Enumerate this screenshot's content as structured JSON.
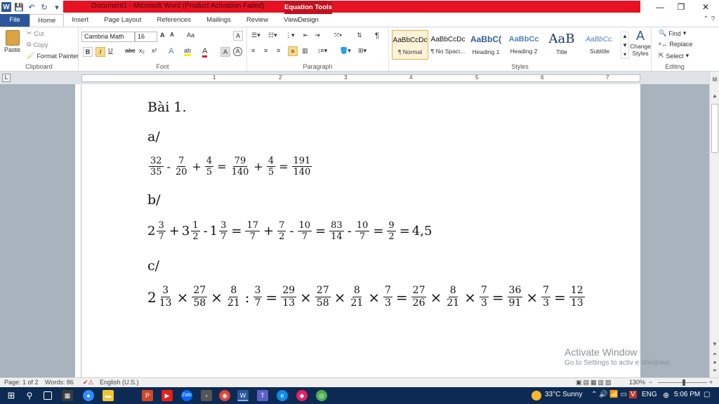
{
  "window": {
    "title": "Document1  -  Microsoft Word (Product Activation Failed)",
    "context_tab": "Equation Tools",
    "minimize": "—",
    "restore": "❐",
    "close": "✕"
  },
  "qat": {
    "word": "W",
    "save": "💾",
    "undo": "↶",
    "redo": "↻",
    "customize": "▾"
  },
  "tabs": {
    "file": "File",
    "items": [
      "Home",
      "Insert",
      "Page Layout",
      "References",
      "Mailings",
      "Review",
      "View"
    ],
    "design": "Design",
    "help": "⌃ ?"
  },
  "ribbon": {
    "clipboard": {
      "label": "Clipboard",
      "paste": "Paste",
      "cut": "Cut",
      "copy": "Copy",
      "format_painter": "Format Painter"
    },
    "font": {
      "label": "Font",
      "family": "Cambria Math",
      "size": "16",
      "grow": "A",
      "shrink": "A",
      "case": "Aa",
      "clear": "A",
      "bold": "B",
      "italic": "I",
      "underline": "U",
      "strike": "abc",
      "sub": "x₂",
      "sup": "x²",
      "effects": "A",
      "highlight": "ab",
      "color": "A",
      "shade": "A",
      "circle": "A"
    },
    "paragraph": {
      "label": "Paragraph",
      "pilcrow": "¶"
    },
    "styles": {
      "label": "Styles",
      "items": [
        {
          "preview": "AaBbCcDc",
          "name": "¶ Normal"
        },
        {
          "preview": "AaBbCcDc",
          "name": "¶ No Spaci..."
        },
        {
          "preview": "AaBbC(",
          "name": "Heading 1"
        },
        {
          "preview": "AaBbCc",
          "name": "Heading 2"
        },
        {
          "preview": "AaB",
          "name": "Title"
        },
        {
          "preview": "AaBbCc.",
          "name": "Subtitle"
        }
      ],
      "change_styles": "Change Styles"
    },
    "editing": {
      "label": "Editing",
      "find": "Find",
      "replace": "Replace",
      "select": "Select"
    }
  },
  "ruler": {
    "numbers": [
      "1",
      "2",
      "3",
      "4",
      "5",
      "6",
      "7"
    ]
  },
  "document": {
    "heading": "Bài 1.",
    "part_a": "a/",
    "eq_a": {
      "f1": [
        "32",
        "35"
      ],
      "op1": "-",
      "f2": [
        "7",
        "20"
      ],
      "op2": "+",
      "f3": [
        "4",
        "5"
      ],
      "eq1": "=",
      "f4": [
        "79",
        "140"
      ],
      "op3": "+",
      "f5": [
        "4",
        "5"
      ],
      "eq2": "=",
      "f6": [
        "191",
        "140"
      ]
    },
    "part_b": "b/",
    "eq_b": {
      "w1": "2",
      "m1": [
        "3",
        "7"
      ],
      "op1": "+",
      "w2": "3",
      "m2": [
        "1",
        "2"
      ],
      "op2": "-",
      "w3": "1",
      "m3": [
        "3",
        "7"
      ],
      "eq1": "=",
      "f1": [
        "17",
        "7"
      ],
      "op3": "+",
      "f2": [
        "7",
        "2"
      ],
      "op4": "-",
      "f3": [
        "10",
        "7"
      ],
      "eq2": "=",
      "f4": [
        "83",
        "14"
      ],
      "op5": "-",
      "f5": [
        "10",
        "7"
      ],
      "eq3": "=",
      "f6": [
        "9",
        "2"
      ],
      "eq4": "=",
      "result": "4,5"
    },
    "part_c": "c/",
    "eq_c": {
      "w1": "2",
      "m1": [
        "3",
        "13"
      ],
      "op1": "×",
      "f1": [
        "27",
        "58"
      ],
      "op2": "×",
      "f2": [
        "8",
        "21"
      ],
      "op3": ":",
      "f3": [
        "3",
        "7"
      ],
      "eq1": "=",
      "f4": [
        "29",
        "13"
      ],
      "op4": "×",
      "f5": [
        "27",
        "58"
      ],
      "op5": "×",
      "f6": [
        "8",
        "21"
      ],
      "op6": "×",
      "f7": [
        "7",
        "3"
      ],
      "eq2": "=",
      "f8": [
        "27",
        "26"
      ],
      "op7": "×",
      "f9": [
        "8",
        "21"
      ],
      "op8": "×",
      "f10": [
        "7",
        "3"
      ],
      "eq3": "=",
      "f11": [
        "36",
        "91"
      ],
      "op9": "×",
      "f12": [
        "7",
        "3"
      ],
      "eq4": "=",
      "f13": [
        "12",
        "13"
      ]
    }
  },
  "watermark": {
    "line1": "Activate Window",
    "line2": "Go to Settings to activ   e Windows."
  },
  "status": {
    "page": "Page: 1 of 2",
    "words": "Words: 86",
    "language": "English (U.S.)",
    "zoom": "130%",
    "zoom_minus": "−",
    "zoom_plus": "+"
  },
  "taskbar": {
    "weather": "33°C  Sunny",
    "lang": "ENG",
    "time": "5:06 PM"
  }
}
